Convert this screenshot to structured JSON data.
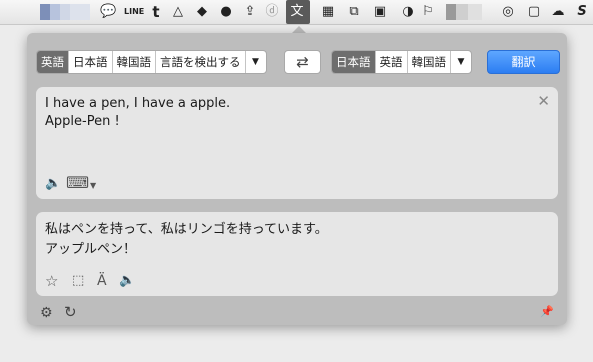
{
  "menubar": {
    "icons": [
      "speech-bubble-icon",
      "line-app-icon",
      "tumblr-icon",
      "google-drive-icon",
      "hat-icon",
      "dashlane-icon",
      "translate-icon",
      "window-grid-icon",
      "clone-icon",
      "keyboard-icon",
      "toggle-icon",
      "flag-icon",
      "activity-icon",
      "notes-icon",
      "cloud-icon",
      "s-logo-icon"
    ],
    "line_label": "LINE",
    "t_label": "t"
  },
  "translator": {
    "source_langs": [
      {
        "label": "英語",
        "selected": true
      },
      {
        "label": "日本語",
        "selected": false
      },
      {
        "label": "韓国語",
        "selected": false
      },
      {
        "label": "言語を検出する",
        "selected": false
      }
    ],
    "target_langs": [
      {
        "label": "日本語",
        "selected": true
      },
      {
        "label": "英語",
        "selected": false
      },
      {
        "label": "韓国語",
        "selected": false
      }
    ],
    "swap_glyph": "⇄",
    "dropdown_glyph": "▼",
    "translate_label": "翻訳",
    "source_text": "I have a pen, I have a apple.\nApple-Pen !",
    "output_text": "私はペンを持って、私はリンゴを持っています。\nアップルペン！",
    "clear_glyph": "✕",
    "speaker_glyph": "🔈",
    "keyboard_glyph": "⌨",
    "star_glyph": "☆",
    "copy_glyph": "⬚",
    "font_glyph": "Ä",
    "settings_glyph": "⚙",
    "refresh_glyph": "↻",
    "pin_glyph": "📌"
  }
}
